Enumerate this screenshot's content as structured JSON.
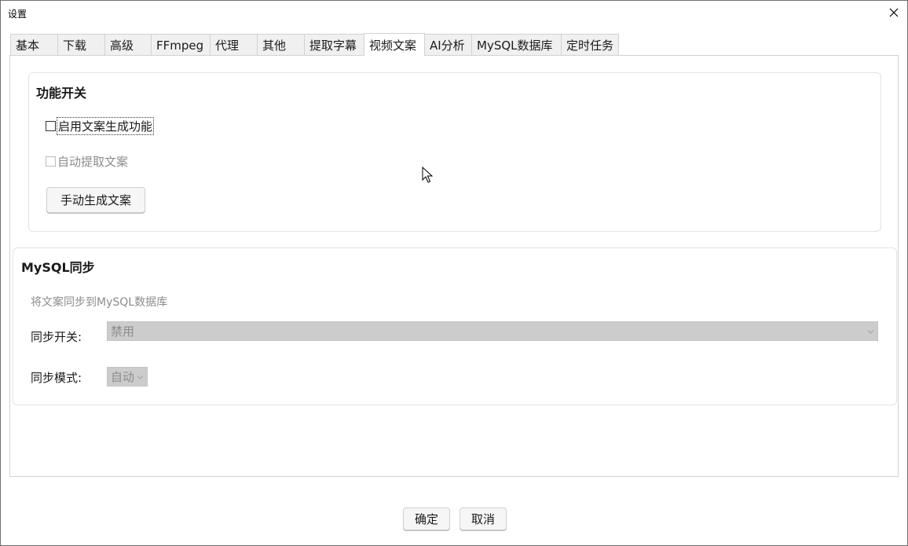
{
  "window": {
    "title": "设置"
  },
  "tabs": [
    {
      "label": "基本",
      "active": false
    },
    {
      "label": "下载",
      "active": false
    },
    {
      "label": "高级",
      "active": false
    },
    {
      "label": "FFmpeg",
      "active": false
    },
    {
      "label": "代理",
      "active": false
    },
    {
      "label": "其他",
      "active": false
    },
    {
      "label": "提取字幕",
      "active": false
    },
    {
      "label": "视频文案",
      "active": true
    },
    {
      "label": "AI分析",
      "active": false
    },
    {
      "label": "MySQL数据库",
      "active": false
    },
    {
      "label": "定时任务",
      "active": false
    }
  ],
  "feature_group": {
    "title": "功能开关",
    "enable_label": "启用文案生成功能",
    "enable_checked": false,
    "auto_extract_label": "自动提取文案",
    "auto_extract_checked": false,
    "manual_button": "手动生成文案"
  },
  "mysql_group": {
    "title": "MySQL同步",
    "hint": "将文案同步到MySQL数据库",
    "sync_switch_label": "同步开关:",
    "sync_switch_value": "禁用",
    "sync_mode_label": "同步模式:",
    "sync_mode_value": "自动"
  },
  "footer": {
    "ok_label": "确定",
    "cancel_label": "取消"
  }
}
